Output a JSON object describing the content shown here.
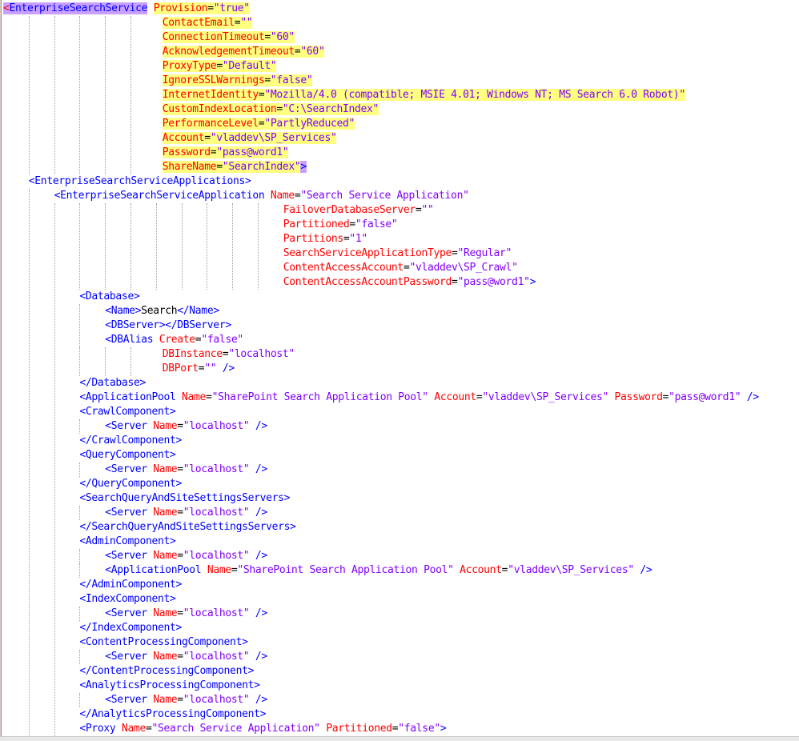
{
  "lines": [
    {
      "indent": 0,
      "segs": [
        [
          "caret",
          "<"
        ],
        [
          "tagH",
          "EnterpriseSearchService"
        ],
        [
          "sp",
          " "
        ],
        [
          "aH",
          "Provision"
        ],
        [
          "eqH",
          "="
        ],
        [
          "vH",
          "\"true\""
        ]
      ]
    },
    {
      "indent": 25,
      "segs": [
        [
          "aH",
          "ContactEmail"
        ],
        [
          "eqH",
          "="
        ],
        [
          "vH",
          "\"\""
        ]
      ]
    },
    {
      "indent": 25,
      "segs": [
        [
          "aH",
          "ConnectionTimeout"
        ],
        [
          "eqH",
          "="
        ],
        [
          "vH",
          "\"60\""
        ]
      ]
    },
    {
      "indent": 25,
      "segs": [
        [
          "aH",
          "AcknowledgementTimeout"
        ],
        [
          "eqH",
          "="
        ],
        [
          "vH",
          "\"60\""
        ]
      ]
    },
    {
      "indent": 25,
      "segs": [
        [
          "aH",
          "ProxyType"
        ],
        [
          "eqH",
          "="
        ],
        [
          "vH",
          "\"Default\""
        ]
      ]
    },
    {
      "indent": 25,
      "segs": [
        [
          "aH",
          "IgnoreSSLWarnings"
        ],
        [
          "eqH",
          "="
        ],
        [
          "vH",
          "\"false\""
        ]
      ]
    },
    {
      "indent": 25,
      "segs": [
        [
          "aH",
          "InternetIdentity"
        ],
        [
          "eqH",
          "="
        ],
        [
          "vH",
          "\"Mozilla/4.0 (compatible; MSIE 4.01; Windows NT; MS Search 6.0 Robot)\""
        ]
      ]
    },
    {
      "indent": 25,
      "segs": [
        [
          "aH",
          "CustomIndexLocation"
        ],
        [
          "eqH",
          "="
        ],
        [
          "vH",
          "\"C:\\SearchIndex\""
        ]
      ]
    },
    {
      "indent": 25,
      "segs": [
        [
          "aH",
          "PerformanceLevel"
        ],
        [
          "eqH",
          "="
        ],
        [
          "vH",
          "\"PartlyReduced\""
        ]
      ]
    },
    {
      "indent": 25,
      "segs": [
        [
          "aH",
          "Account"
        ],
        [
          "eqH",
          "="
        ],
        [
          "vH",
          "\"vladdev\\SP_Services\""
        ]
      ]
    },
    {
      "indent": 25,
      "segs": [
        [
          "aH",
          "Password"
        ],
        [
          "eqH",
          "="
        ],
        [
          "vH",
          "\"pass@word1\""
        ]
      ]
    },
    {
      "indent": 25,
      "segs": [
        [
          "aH",
          "ShareName"
        ],
        [
          "eqH",
          "="
        ],
        [
          "vH",
          "\"SearchIndex\""
        ],
        [
          "closeP",
          ">"
        ]
      ]
    },
    {
      "indent": 4,
      "segs": [
        [
          "t",
          "<EnterpriseSearchServiceApplications>"
        ]
      ]
    },
    {
      "indent": 8,
      "segs": [
        [
          "t",
          "<EnterpriseSearchServiceApplication "
        ],
        [
          "a",
          "Name"
        ],
        [
          "x",
          "="
        ],
        [
          "v",
          "\"Search Service Application\""
        ]
      ]
    },
    {
      "indent": 44,
      "segs": [
        [
          "a",
          "FailoverDatabaseServer"
        ],
        [
          "x",
          "="
        ],
        [
          "v",
          "\"\""
        ]
      ]
    },
    {
      "indent": 44,
      "segs": [
        [
          "a",
          "Partitioned"
        ],
        [
          "x",
          "="
        ],
        [
          "v",
          "\"false\""
        ]
      ]
    },
    {
      "indent": 44,
      "segs": [
        [
          "a",
          "Partitions"
        ],
        [
          "x",
          "="
        ],
        [
          "v",
          "\"1\""
        ]
      ]
    },
    {
      "indent": 44,
      "segs": [
        [
          "a",
          "SearchServiceApplicationType"
        ],
        [
          "x",
          "="
        ],
        [
          "v",
          "\"Regular\""
        ]
      ]
    },
    {
      "indent": 44,
      "segs": [
        [
          "a",
          "ContentAccessAccount"
        ],
        [
          "x",
          "="
        ],
        [
          "v",
          "\"vladdev\\SP_Crawl\""
        ]
      ]
    },
    {
      "indent": 44,
      "segs": [
        [
          "a",
          "ContentAccessAccountPassword"
        ],
        [
          "x",
          "="
        ],
        [
          "v",
          "\"pass@word1\""
        ],
        [
          "t",
          ">"
        ]
      ]
    },
    {
      "indent": 12,
      "segs": [
        [
          "t",
          "<Database>"
        ]
      ]
    },
    {
      "indent": 16,
      "segs": [
        [
          "t",
          "<Name>"
        ],
        [
          "x",
          "Search"
        ],
        [
          "t",
          "</Name>"
        ]
      ]
    },
    {
      "indent": 16,
      "segs": [
        [
          "t",
          "<DBServer></DBServer>"
        ]
      ]
    },
    {
      "indent": 16,
      "segs": [
        [
          "t",
          "<DBAlias "
        ],
        [
          "a",
          "Create"
        ],
        [
          "x",
          "="
        ],
        [
          "v",
          "\"false\""
        ]
      ]
    },
    {
      "indent": 25,
      "segs": [
        [
          "a",
          "DBInstance"
        ],
        [
          "x",
          "="
        ],
        [
          "v",
          "\"localhost\""
        ]
      ]
    },
    {
      "indent": 25,
      "segs": [
        [
          "a",
          "DBPort"
        ],
        [
          "x",
          "="
        ],
        [
          "v",
          "\"\""
        ],
        [
          "t",
          " />"
        ]
      ]
    },
    {
      "indent": 12,
      "segs": [
        [
          "t",
          "</Database>"
        ]
      ]
    },
    {
      "indent": 12,
      "segs": [
        [
          "t",
          "<ApplicationPool "
        ],
        [
          "a",
          "Name"
        ],
        [
          "x",
          "="
        ],
        [
          "v",
          "\"SharePoint Search Application Pool\""
        ],
        [
          "t",
          " "
        ],
        [
          "a",
          "Account"
        ],
        [
          "x",
          "="
        ],
        [
          "v",
          "\"vladdev\\SP_Services\""
        ],
        [
          "t",
          " "
        ],
        [
          "a",
          "Password"
        ],
        [
          "x",
          "="
        ],
        [
          "v",
          "\"pass@word1\""
        ],
        [
          "t",
          " />"
        ]
      ]
    },
    {
      "indent": 12,
      "segs": [
        [
          "t",
          "<CrawlComponent>"
        ]
      ]
    },
    {
      "indent": 16,
      "segs": [
        [
          "t",
          "<Server "
        ],
        [
          "a",
          "Name"
        ],
        [
          "x",
          "="
        ],
        [
          "v",
          "\"localhost\""
        ],
        [
          "t",
          " />"
        ]
      ]
    },
    {
      "indent": 12,
      "segs": [
        [
          "t",
          "</CrawlComponent>"
        ]
      ]
    },
    {
      "indent": 12,
      "segs": [
        [
          "t",
          "<QueryComponent>"
        ]
      ]
    },
    {
      "indent": 16,
      "segs": [
        [
          "t",
          "<Server "
        ],
        [
          "a",
          "Name"
        ],
        [
          "x",
          "="
        ],
        [
          "v",
          "\"localhost\""
        ],
        [
          "t",
          " />"
        ]
      ]
    },
    {
      "indent": 12,
      "segs": [
        [
          "t",
          "</QueryComponent>"
        ]
      ]
    },
    {
      "indent": 12,
      "segs": [
        [
          "t",
          "<SearchQueryAndSiteSettingsServers>"
        ]
      ]
    },
    {
      "indent": 16,
      "segs": [
        [
          "t",
          "<Server "
        ],
        [
          "a",
          "Name"
        ],
        [
          "x",
          "="
        ],
        [
          "v",
          "\"localhost\""
        ],
        [
          "t",
          " />"
        ]
      ]
    },
    {
      "indent": 12,
      "segs": [
        [
          "t",
          "</SearchQueryAndSiteSettingsServers>"
        ]
      ]
    },
    {
      "indent": 12,
      "segs": [
        [
          "t",
          "<AdminComponent>"
        ]
      ]
    },
    {
      "indent": 16,
      "segs": [
        [
          "t",
          "<Server "
        ],
        [
          "a",
          "Name"
        ],
        [
          "x",
          "="
        ],
        [
          "v",
          "\"localhost\""
        ],
        [
          "t",
          " />"
        ]
      ]
    },
    {
      "indent": 16,
      "segs": [
        [
          "t",
          "<ApplicationPool "
        ],
        [
          "a",
          "Name"
        ],
        [
          "x",
          "="
        ],
        [
          "v",
          "\"SharePoint Search Application Pool\""
        ],
        [
          "t",
          " "
        ],
        [
          "a",
          "Account"
        ],
        [
          "x",
          "="
        ],
        [
          "v",
          "\"vladdev\\SP_Services\""
        ],
        [
          "t",
          " />"
        ]
      ]
    },
    {
      "indent": 12,
      "segs": [
        [
          "t",
          "</AdminComponent>"
        ]
      ]
    },
    {
      "indent": 12,
      "segs": [
        [
          "t",
          "<IndexComponent>"
        ]
      ]
    },
    {
      "indent": 16,
      "segs": [
        [
          "t",
          "<Server "
        ],
        [
          "a",
          "Name"
        ],
        [
          "x",
          "="
        ],
        [
          "v",
          "\"localhost\""
        ],
        [
          "t",
          " />"
        ]
      ]
    },
    {
      "indent": 12,
      "segs": [
        [
          "t",
          "</IndexComponent>"
        ]
      ]
    },
    {
      "indent": 12,
      "segs": [
        [
          "t",
          "<ContentProcessingComponent>"
        ]
      ]
    },
    {
      "indent": 16,
      "segs": [
        [
          "t",
          "<Server "
        ],
        [
          "a",
          "Name"
        ],
        [
          "x",
          "="
        ],
        [
          "v",
          "\"localhost\""
        ],
        [
          "t",
          " />"
        ]
      ]
    },
    {
      "indent": 12,
      "segs": [
        [
          "t",
          "</ContentProcessingComponent>"
        ]
      ]
    },
    {
      "indent": 12,
      "segs": [
        [
          "t",
          "<AnalyticsProcessingComponent>"
        ]
      ]
    },
    {
      "indent": 16,
      "segs": [
        [
          "t",
          "<Server "
        ],
        [
          "a",
          "Name"
        ],
        [
          "x",
          "="
        ],
        [
          "v",
          "\"localhost\""
        ],
        [
          "t",
          " />"
        ]
      ]
    },
    {
      "indent": 12,
      "segs": [
        [
          "t",
          "</AnalyticsProcessingComponent>"
        ]
      ]
    },
    {
      "indent": 12,
      "segs": [
        [
          "t",
          "<Proxy "
        ],
        [
          "a",
          "Name"
        ],
        [
          "x",
          "="
        ],
        [
          "v",
          "\"Search Service Application\""
        ],
        [
          "t",
          " "
        ],
        [
          "a",
          "Partitioned"
        ],
        [
          "x",
          "="
        ],
        [
          "v",
          "\"false\""
        ],
        [
          "t",
          ">"
        ]
      ]
    }
  ],
  "colors": {
    "tag": "#0000ff",
    "attr": "#ff0000",
    "value": "#8000ff",
    "text": "#000000",
    "highlight": "#ffff80",
    "match": "#c8a0ff"
  }
}
